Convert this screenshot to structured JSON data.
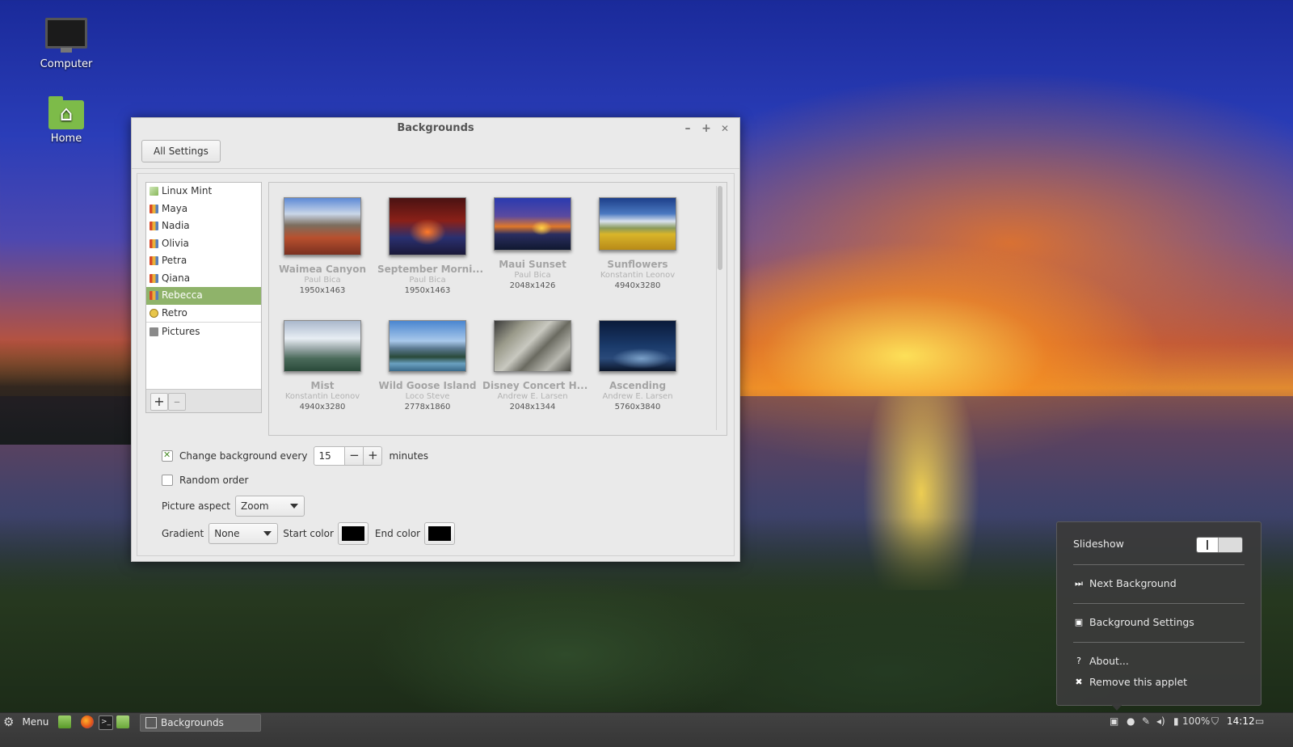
{
  "desktop": {
    "icons": [
      {
        "label": "Computer",
        "icon": "computer-icon"
      },
      {
        "label": "Home",
        "icon": "home-folder-icon"
      }
    ]
  },
  "window": {
    "title": "Backgrounds",
    "controls": {
      "minimize": "–",
      "maximize": "+",
      "close": "✕"
    },
    "all_settings_label": "All Settings"
  },
  "sidebar": {
    "items": [
      {
        "label": "Linux Mint",
        "icon": "linuxmint-icon"
      },
      {
        "label": "Maya",
        "icon": "pictures-collection-icon"
      },
      {
        "label": "Nadia",
        "icon": "pictures-collection-icon"
      },
      {
        "label": "Olivia",
        "icon": "pictures-collection-icon"
      },
      {
        "label": "Petra",
        "icon": "pictures-collection-icon"
      },
      {
        "label": "Qiana",
        "icon": "pictures-collection-icon"
      },
      {
        "label": "Rebecca",
        "icon": "pictures-collection-icon",
        "selected": true
      },
      {
        "label": "Retro",
        "icon": "retro-icon"
      },
      {
        "label": "Pictures",
        "icon": "folder-icon"
      }
    ],
    "add_label": "+",
    "remove_label": "–"
  },
  "wallpapers": [
    {
      "name": "Waimea Canyon",
      "author": "Paul Bica",
      "size": "1950x1463"
    },
    {
      "name": "September Morni...",
      "author": "Paul Bica",
      "size": "1950x1463"
    },
    {
      "name": "Maui Sunset",
      "author": "Paul Bica",
      "size": "2048x1426"
    },
    {
      "name": "Sunflowers",
      "author": "Konstantin Leonov",
      "size": "4940x3280"
    },
    {
      "name": "Mist",
      "author": "Konstantin Leonov",
      "size": "4940x3280"
    },
    {
      "name": "Wild Goose Island",
      "author": "Loco Steve",
      "size": "2778x1860"
    },
    {
      "name": "Disney Concert H...",
      "author": "Andrew E. Larsen",
      "size": "2048x1344"
    },
    {
      "name": "Ascending",
      "author": "Andrew E. Larsen",
      "size": "5760x3840"
    }
  ],
  "options": {
    "change_background_label": "Change background every",
    "change_background_checked": true,
    "interval_value": "15",
    "interval_minus": "−",
    "interval_plus": "+",
    "minutes_label": "minutes",
    "random_order_label": "Random order",
    "random_order_checked": false,
    "picture_aspect_label": "Picture aspect",
    "picture_aspect_value": "Zoom",
    "gradient_label": "Gradient",
    "gradient_value": "None",
    "start_color_label": "Start color",
    "start_color": "#000000",
    "end_color_label": "End color",
    "end_color": "#000000"
  },
  "popup": {
    "slideshow_label": "Slideshow",
    "slideshow_on": false,
    "next_background_label": "Next Background",
    "background_settings_label": "Background Settings",
    "about_label": "About...",
    "remove_applet_label": "Remove this applet"
  },
  "taskbar": {
    "menu_label": "Menu",
    "task_label": "Backgrounds",
    "battery_label": "100%",
    "clock": "14:12"
  },
  "colors": {
    "selection": "#8fb36a",
    "panel": "#3c3c3c",
    "window_bg": "#eaeaea"
  }
}
